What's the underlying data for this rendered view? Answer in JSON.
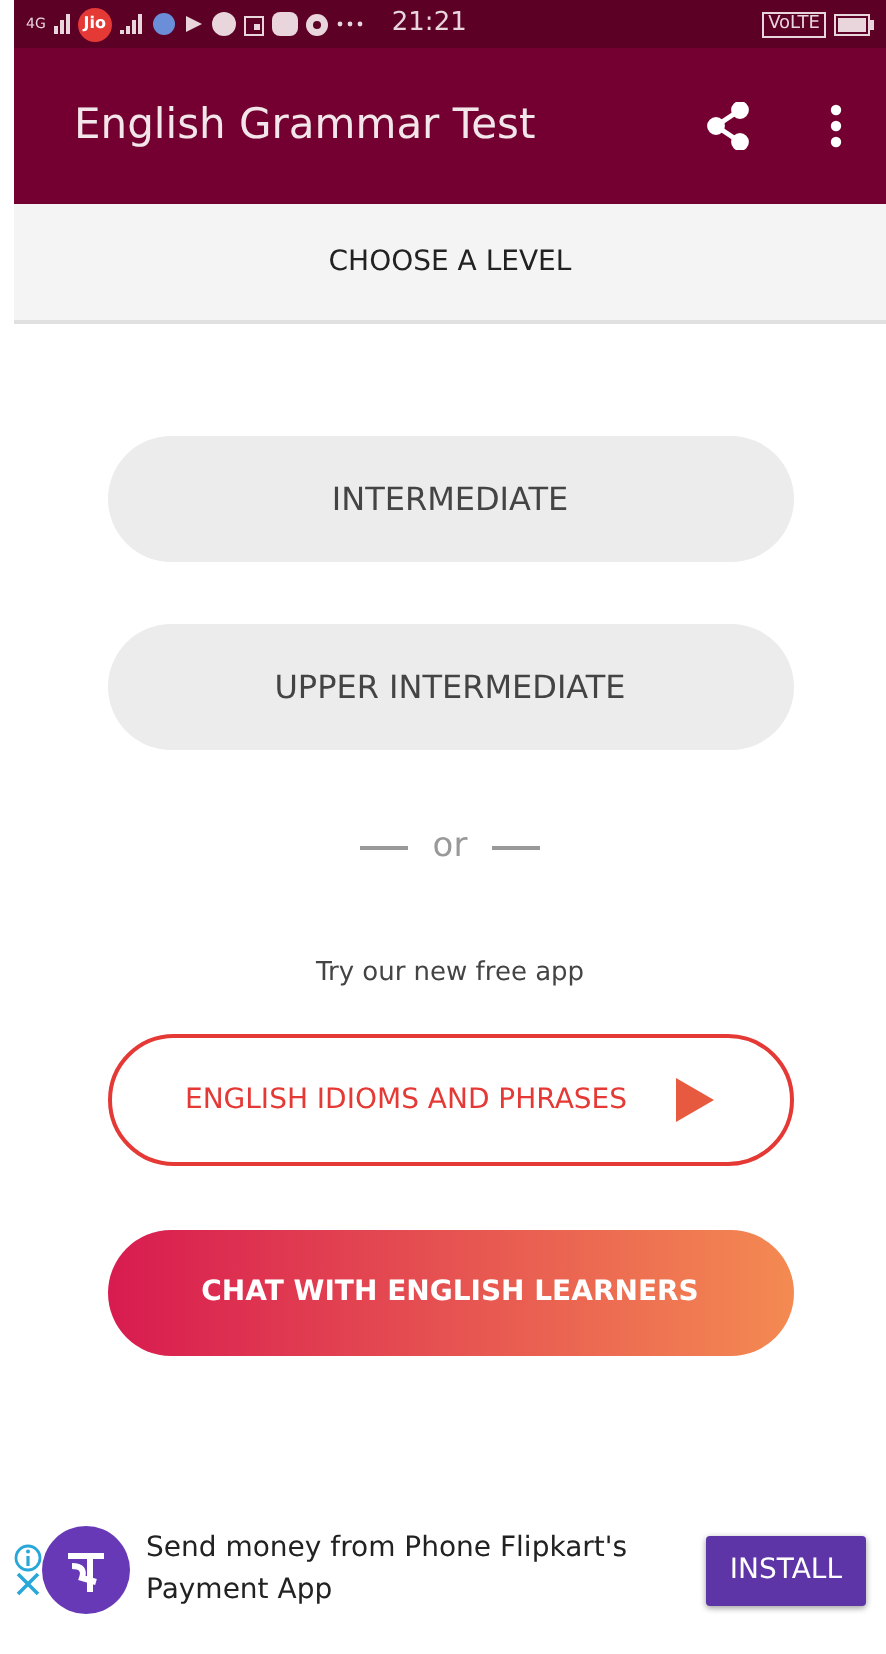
{
  "status_bar": {
    "network": "4G",
    "carrier": "Jio",
    "time": "21:21",
    "volte": "VoLTE"
  },
  "app_bar": {
    "title": "English Grammar Test"
  },
  "tabs": [
    {
      "label": "CHOOSE A LEVEL",
      "selected": true
    }
  ],
  "levels": [
    {
      "label": "INTERMEDIATE"
    },
    {
      "label": "UPPER INTERMEDIATE"
    }
  ],
  "separator": "or",
  "promo_text": "Try our new free app",
  "promo_buttons": [
    {
      "kind": "outline",
      "label": "ENGLISH IDIOMS AND PHRASES"
    },
    {
      "kind": "gradient",
      "label": "CHAT WITH ENGLISH LEARNERS"
    }
  ],
  "ad": {
    "text": "Send money from Phone Flipkart's Payment App",
    "button": "INSTALL"
  }
}
